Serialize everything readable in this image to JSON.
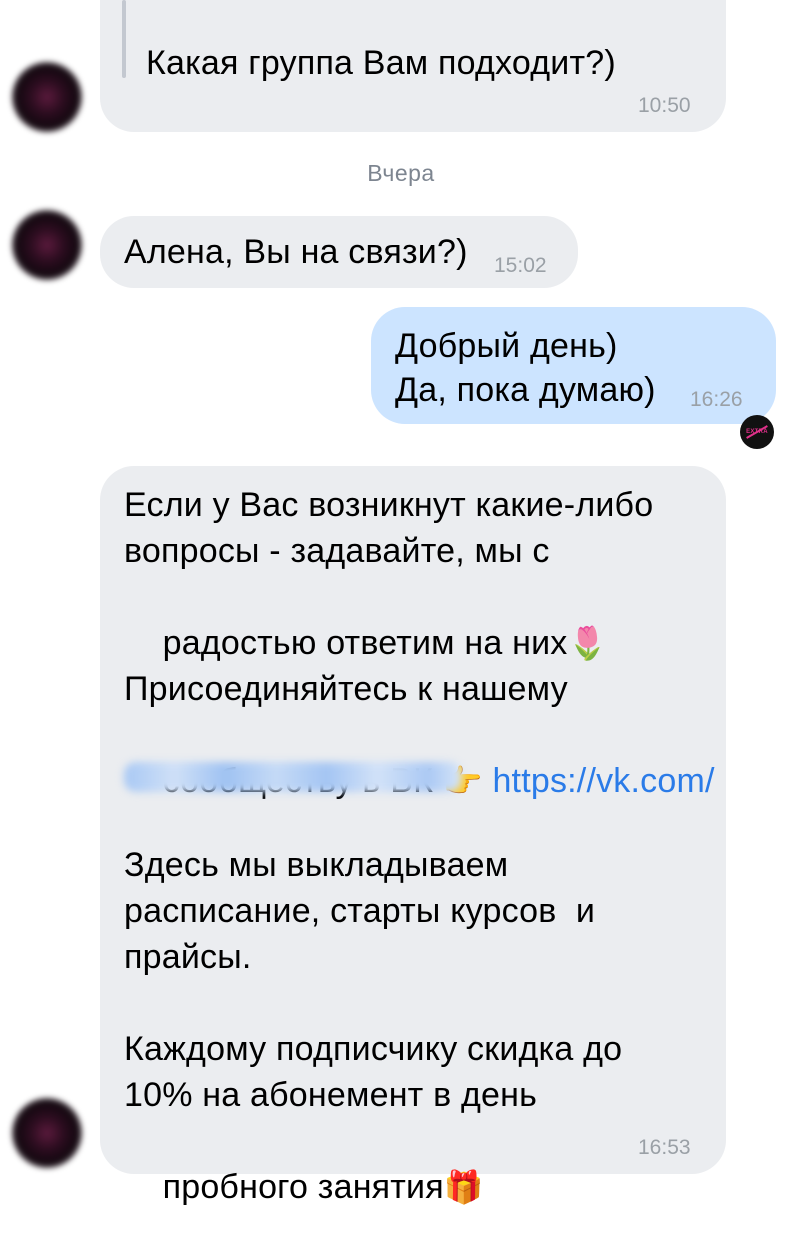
{
  "messages": [
    {
      "id": "m1",
      "direction": "incoming",
      "text": "Какая группа Вам подходит?)",
      "time": "10:50"
    },
    {
      "id": "m2",
      "direction": "incoming",
      "text": "Алена, Вы на связи?)",
      "time": "15:02"
    },
    {
      "id": "m3",
      "direction": "outgoing",
      "lines": [
        "Добрый день)",
        "Да, пока думаю)"
      ],
      "time": "16:26"
    },
    {
      "id": "m4",
      "direction": "incoming",
      "lines": [
        "Если у Вас возникнут какие-либо",
        "вопросы - задавайте, мы с",
        "радостью ответим на них",
        "Присоединяйтесь к нашему",
        "сообществу в ВК ",
        "https://vk.com/",
        "Здесь мы выкладываем",
        "расписание, старты курсов  и",
        "прайсы.",
        "Каждому подписчику скидка до",
        "10% на абонемент в день",
        "пробного занятия"
      ],
      "time": "16:53"
    }
  ],
  "date_separator": "Вчера",
  "emojis": {
    "tulip": "🌷",
    "pointing_hand": "👉",
    "gift": "🎁"
  },
  "own_avatar_label": "EXTRA",
  "colors": {
    "incoming_bubble": "#ebedf0",
    "outgoing_bubble": "#cce4ff",
    "link": "#2a7be8",
    "timestamp": "#9aa0a6"
  }
}
